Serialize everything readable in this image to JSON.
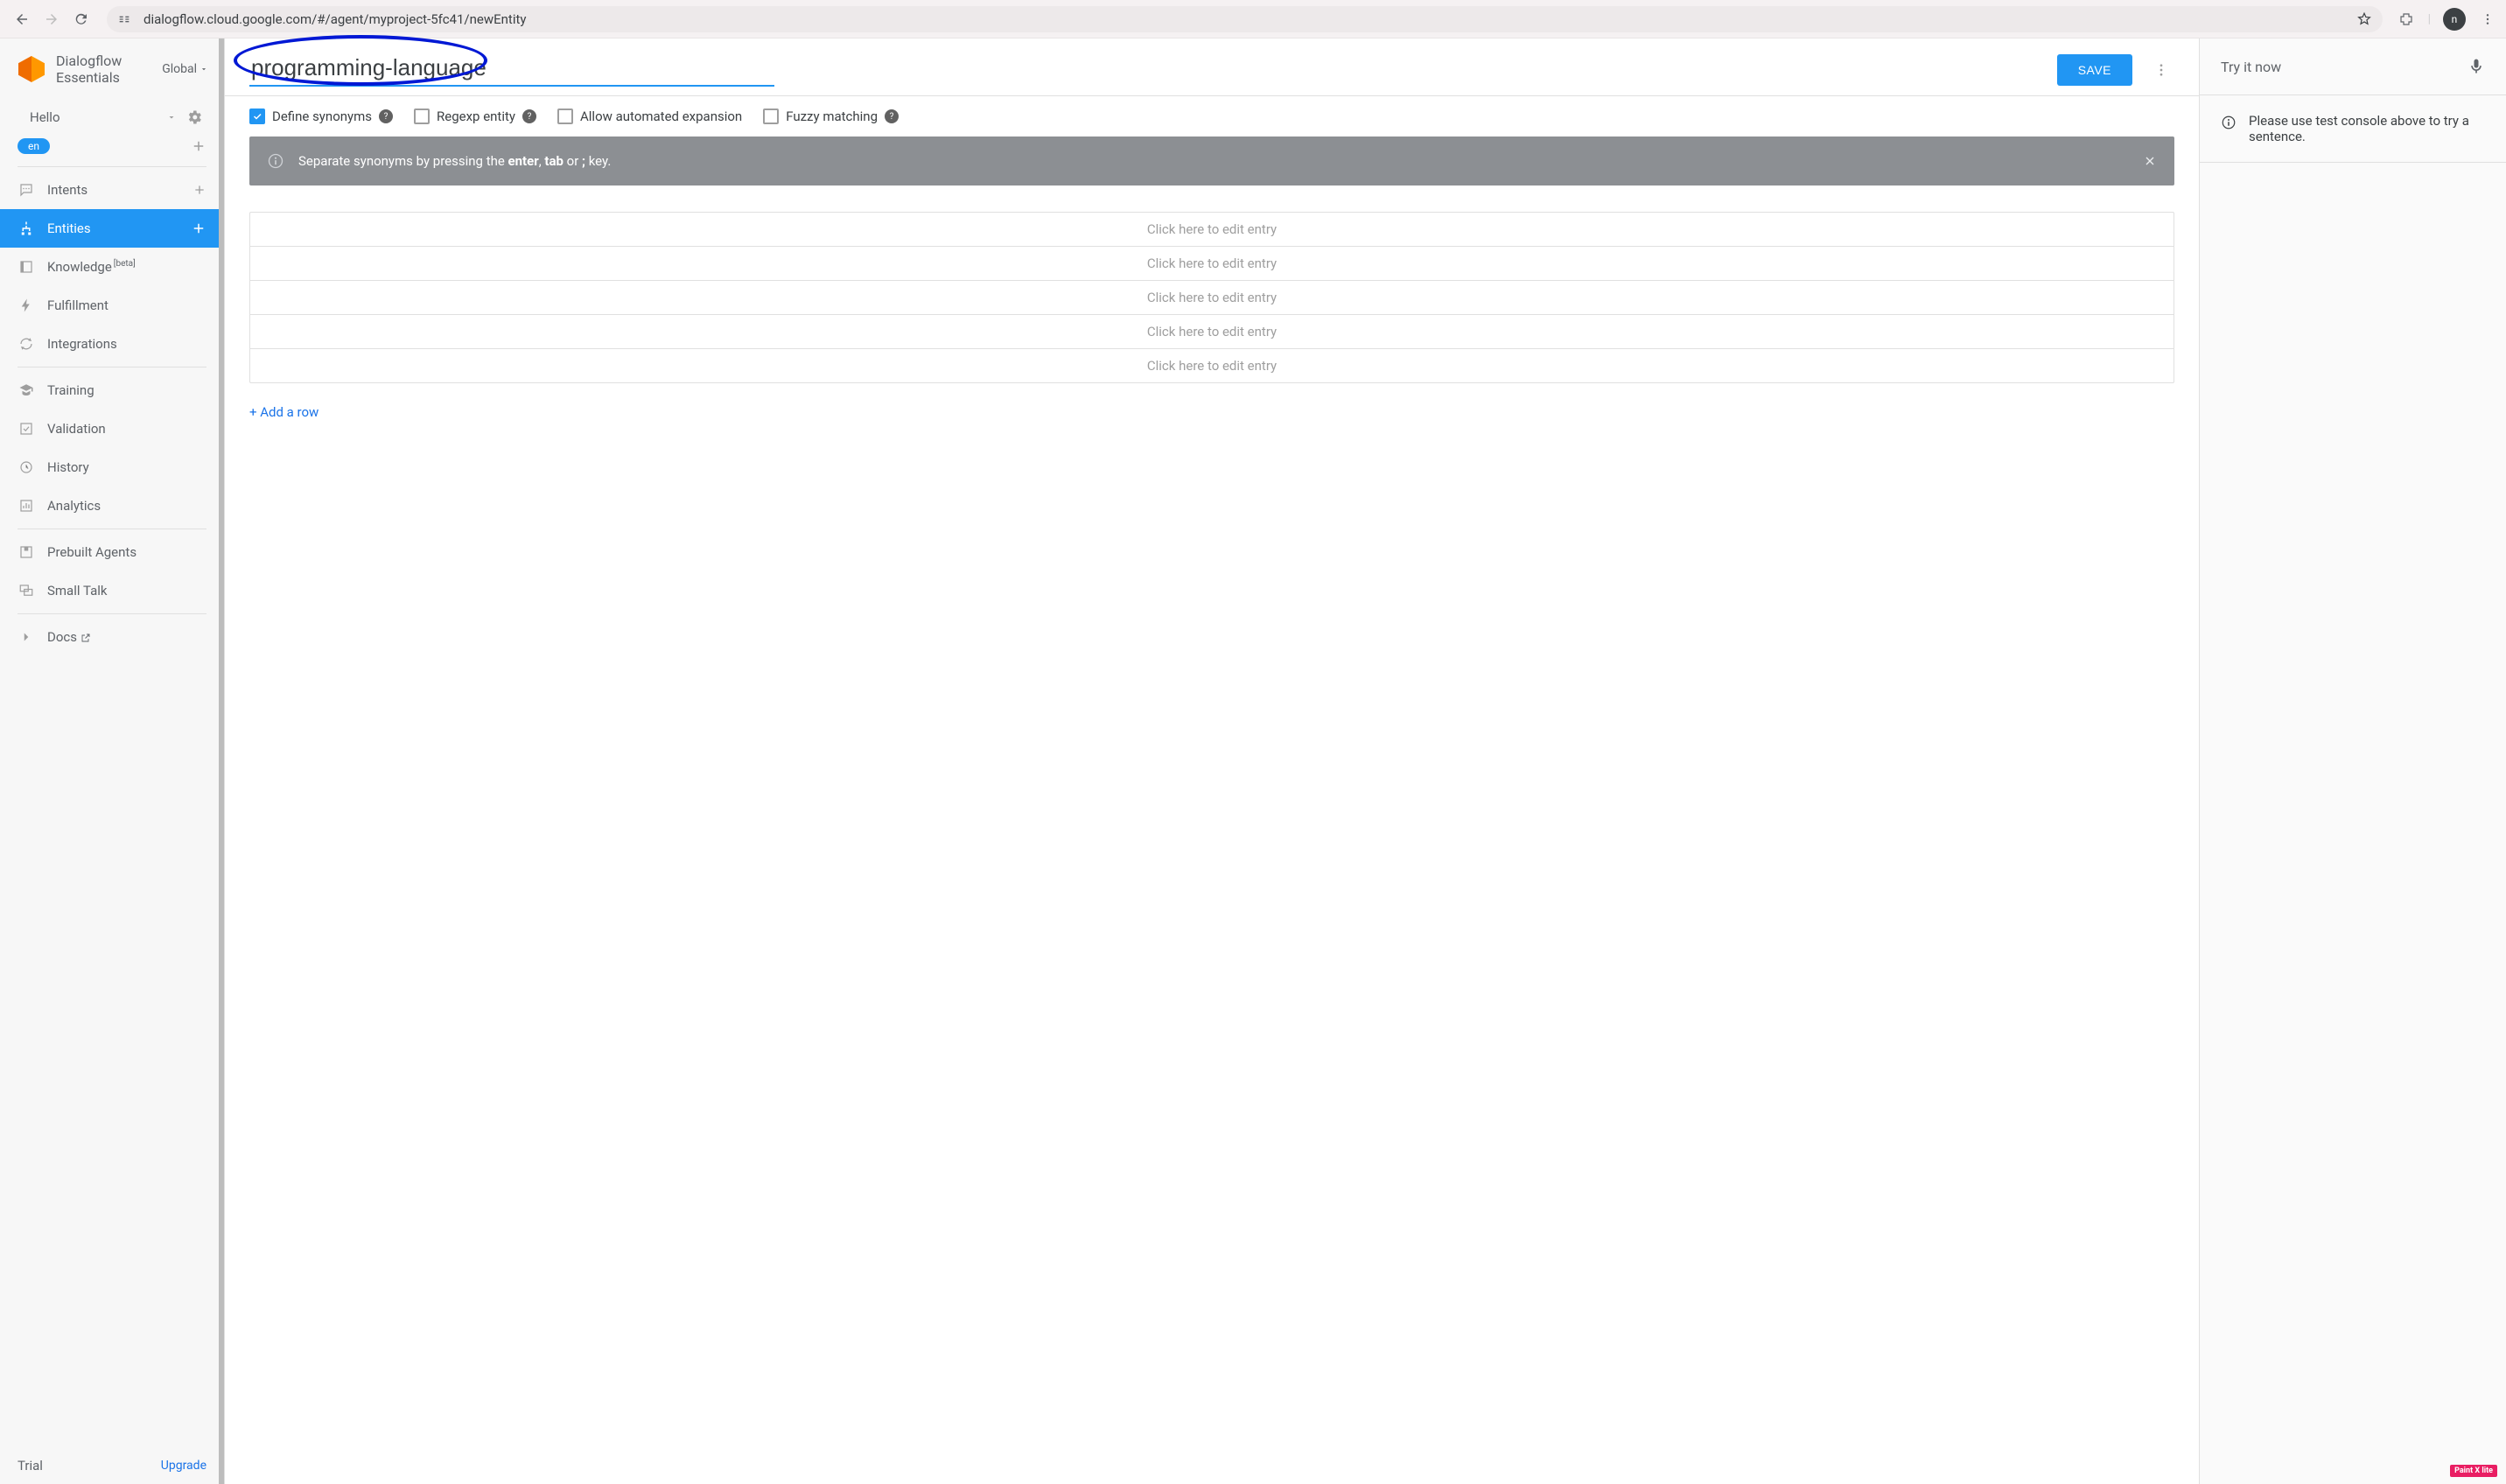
{
  "browser": {
    "url": "dialogflow.cloud.google.com/#/agent/myproject-5fc41/newEntity",
    "avatar_letter": "n"
  },
  "brand": {
    "line1": "Dialogflow",
    "line2": "Essentials",
    "scope": "Global"
  },
  "agent": {
    "name": "Hello",
    "language": "en"
  },
  "nav": {
    "intents": "Intents",
    "entities": "Entities",
    "knowledge": "Knowledge",
    "knowledge_badge": "[beta]",
    "fulfillment": "Fulfillment",
    "integrations": "Integrations",
    "training": "Training",
    "validation": "Validation",
    "history": "History",
    "analytics": "Analytics",
    "prebuilt": "Prebuilt Agents",
    "smalltalk": "Small Talk",
    "docs": "Docs"
  },
  "footer": {
    "trial": "Trial",
    "upgrade": "Upgrade"
  },
  "entity": {
    "name": "programming-language",
    "save": "SAVE"
  },
  "options": {
    "define_synonyms": "Define synonyms",
    "regexp": "Regexp entity",
    "auto_expand": "Allow automated expansion",
    "fuzzy": "Fuzzy matching"
  },
  "banner": {
    "prefix": "Separate synonyms by pressing the ",
    "k1": "enter",
    "sep1": ", ",
    "k2": "tab",
    "sep2": " or ",
    "k3": ";",
    "suffix": " key."
  },
  "entries": {
    "placeholder": "Click here to edit entry",
    "rows": [
      null,
      null,
      null,
      null,
      null
    ]
  },
  "add_row": "+ Add a row",
  "tryit": {
    "title": "Try it now",
    "info": "Please use test console above to try a sentence."
  },
  "corner_badge": "Paint X lite"
}
